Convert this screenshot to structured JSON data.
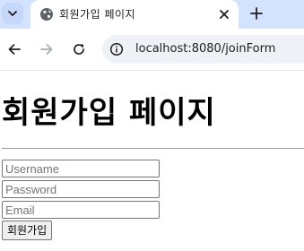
{
  "browser": {
    "tab": {
      "title": "회원가입 페이지"
    },
    "address_bar": {
      "url": "localhost:8080/joinForm"
    },
    "colors": {
      "tabstrip": "#d3e3fd",
      "omnibox": "#eef1f6"
    }
  },
  "page": {
    "heading": "회원가입 페이지",
    "form": {
      "username_placeholder": "Username",
      "password_placeholder": "Password",
      "email_placeholder": "Email",
      "submit_label": "회원가입"
    }
  },
  "icons": [
    "tab-search-icon",
    "globe-icon",
    "close-icon",
    "plus-icon",
    "arrow-left-icon",
    "arrow-right-icon",
    "reload-icon",
    "site-info-icon"
  ]
}
